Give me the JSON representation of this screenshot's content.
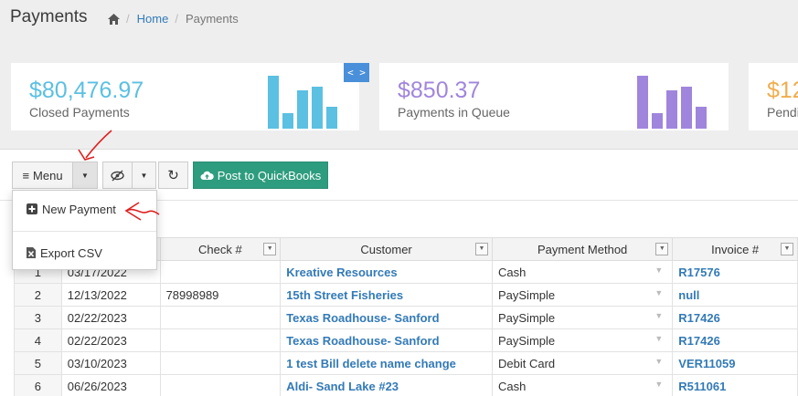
{
  "header": {
    "title": "Payments",
    "breadcrumb": {
      "home": "Home",
      "current": "Payments"
    }
  },
  "cards": [
    {
      "amount": "$80,476.97",
      "label": "Closed Payments",
      "color": "#5bc0e2",
      "bars": [
        1.0,
        0.3,
        0.73,
        0.8,
        0.42
      ]
    },
    {
      "amount": "$850.37",
      "label": "Payments in Queue",
      "color": "#a085dd",
      "bars": [
        1.0,
        0.3,
        0.73,
        0.8,
        0.42
      ]
    },
    {
      "amount": "$12",
      "label": "Pendi",
      "color": "#f0ad4e",
      "bars": []
    }
  ],
  "code_badge": "< >",
  "toolbar": {
    "menu_label": "Menu",
    "post_label": "Post to QuickBooks"
  },
  "dropdown": {
    "new_payment": "New Payment",
    "export_csv": "Export CSV"
  },
  "table": {
    "columns": [
      "Check #",
      "Customer",
      "Payment Method",
      "Invoice #"
    ],
    "rows": [
      {
        "num": "1",
        "date": "03/17/2022",
        "check": "",
        "customer": "Kreative Resources",
        "method": "Cash",
        "invoice": "R17576"
      },
      {
        "num": "2",
        "date": "12/13/2022",
        "check": "78998989",
        "customer": "15th Street Fisheries",
        "method": "PaySimple",
        "invoice": "null"
      },
      {
        "num": "3",
        "date": "02/22/2023",
        "check": "",
        "customer": "Texas Roadhouse- Sanford",
        "method": "PaySimple",
        "invoice": "R17426"
      },
      {
        "num": "4",
        "date": "02/22/2023",
        "check": "",
        "customer": "Texas Roadhouse- Sanford",
        "method": "PaySimple",
        "invoice": "R17426"
      },
      {
        "num": "5",
        "date": "03/10/2023",
        "check": "",
        "customer": "1 test Bill delete name change",
        "method": "Debit Card",
        "invoice": "VER11059"
      },
      {
        "num": "6",
        "date": "06/26/2023",
        "check": "",
        "customer": "Aldi- Sand Lake #23",
        "method": "Cash",
        "invoice": "R511061"
      }
    ]
  }
}
